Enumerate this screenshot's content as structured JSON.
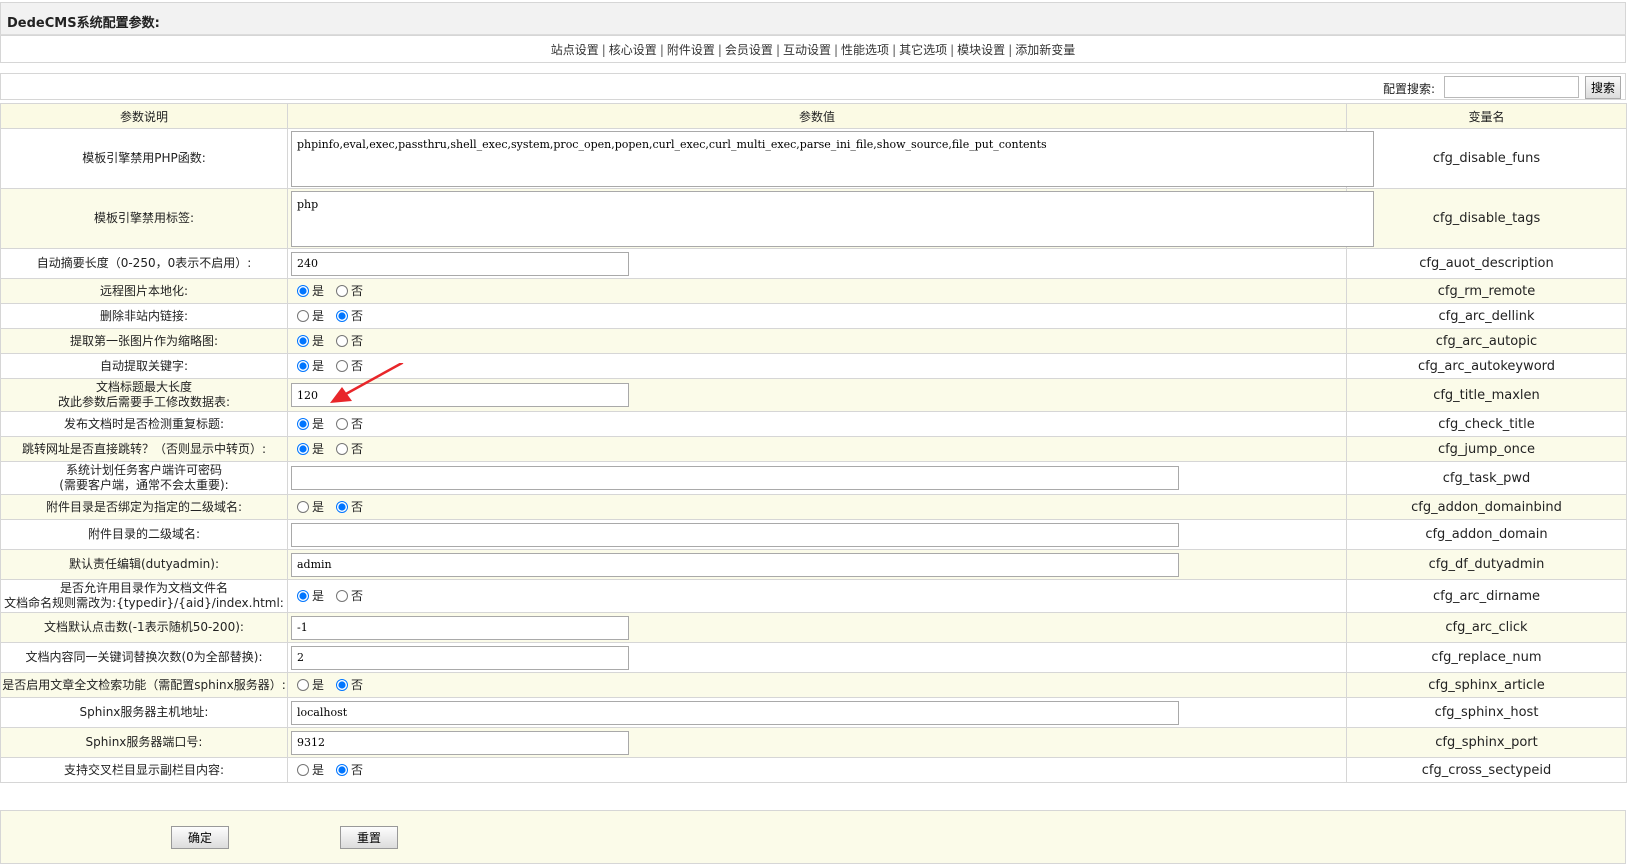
{
  "title": "DedeCMS系统配置参数:",
  "nav": [
    "站点设置",
    "核心设置",
    "附件设置",
    "会员设置",
    "互动设置",
    "性能选项",
    "其它选项",
    "模块设置",
    "添加新变量"
  ],
  "search": {
    "label": "配置搜索:",
    "value": "",
    "button": "搜索"
  },
  "table": {
    "headers": [
      "参数说明",
      "参数值",
      "变量名"
    ],
    "rows": [
      {
        "desc": [
          "模板引擎禁用PHP函数:"
        ],
        "type": "textarea",
        "value": "phpinfo,eval,exec,passthru,shell_exec,system,proc_open,popen,curl_exec,curl_multi_exec,parse_ini_file,show_source,file_put_contents",
        "var": "cfg_disable_funs"
      },
      {
        "desc": [
          "模板引擎禁用标签:"
        ],
        "type": "textarea",
        "value": "php",
        "var": "cfg_disable_tags"
      },
      {
        "desc": [
          "自动摘要长度（0-250，0表示不启用）:"
        ],
        "type": "text-s",
        "value": "240",
        "var": "cfg_auot_description"
      },
      {
        "desc": [
          "远程图片本地化:"
        ],
        "type": "radio",
        "value": "是",
        "var": "cfg_rm_remote"
      },
      {
        "desc": [
          "删除非站内链接:"
        ],
        "type": "radio",
        "value": "否",
        "var": "cfg_arc_dellink"
      },
      {
        "desc": [
          "提取第一张图片作为缩略图:"
        ],
        "type": "radio",
        "value": "是",
        "var": "cfg_arc_autopic"
      },
      {
        "desc": [
          "自动提取关键字:"
        ],
        "type": "radio",
        "value": "是",
        "var": "cfg_arc_autokeyword"
      },
      {
        "desc": [
          "文档标题最大长度",
          "改此参数后需要手工修改数据表:"
        ],
        "type": "text-s",
        "value": "120",
        "var": "cfg_title_maxlen"
      },
      {
        "desc": [
          "发布文档时是否检测重复标题:"
        ],
        "type": "radio",
        "value": "是",
        "var": "cfg_check_title"
      },
      {
        "desc": [
          "跳转网址是否直接跳转？（否则显示中转页）:"
        ],
        "type": "radio",
        "value": "是",
        "var": "cfg_jump_once"
      },
      {
        "desc": [
          "系统计划任务客户端许可密码",
          "(需要客户端，通常不会太重要):"
        ],
        "type": "text-l",
        "value": "",
        "var": "cfg_task_pwd"
      },
      {
        "desc": [
          "附件目录是否绑定为指定的二级域名:"
        ],
        "type": "radio",
        "value": "否",
        "var": "cfg_addon_domainbind"
      },
      {
        "desc": [
          "附件目录的二级域名:"
        ],
        "type": "text-l",
        "value": "",
        "var": "cfg_addon_domain"
      },
      {
        "desc": [
          "默认责任编辑(dutyadmin):"
        ],
        "type": "text-l",
        "value": "admin",
        "var": "cfg_df_dutyadmin"
      },
      {
        "desc": [
          "是否允许用目录作为文档文件名",
          "文档命名规则需改为:{typedir}/{aid}/index.html:"
        ],
        "type": "radio",
        "value": "是",
        "var": "cfg_arc_dirname"
      },
      {
        "desc": [
          "文档默认点击数(-1表示随机50-200):"
        ],
        "type": "text-s",
        "value": "-1",
        "var": "cfg_arc_click"
      },
      {
        "desc": [
          "文档内容同一关键词替换次数(0为全部替换):"
        ],
        "type": "text-s",
        "value": "2",
        "var": "cfg_replace_num"
      },
      {
        "desc": [
          "是否启用文章全文检索功能（需配置sphinx服务器）:"
        ],
        "type": "radio",
        "value": "否",
        "var": "cfg_sphinx_article"
      },
      {
        "desc": [
          "Sphinx服务器主机地址:"
        ],
        "type": "text-l",
        "value": "localhost",
        "var": "cfg_sphinx_host"
      },
      {
        "desc": [
          "Sphinx服务器端口号:"
        ],
        "type": "text-s",
        "value": "9312",
        "var": "cfg_sphinx_port"
      },
      {
        "desc": [
          "支持交叉栏目显示副栏目内容:"
        ],
        "type": "radio",
        "value": "否",
        "var": "cfg_cross_sectypeid"
      }
    ]
  },
  "radio_labels": [
    "是",
    "否"
  ],
  "buttons": {
    "confirm": "确定",
    "reset": "重置"
  },
  "colors": {
    "header_bg": "#fbfae4",
    "alt_row_bg": "#fbfbe9",
    "border": "#d6d6d6",
    "arrow": "#e8262a"
  }
}
